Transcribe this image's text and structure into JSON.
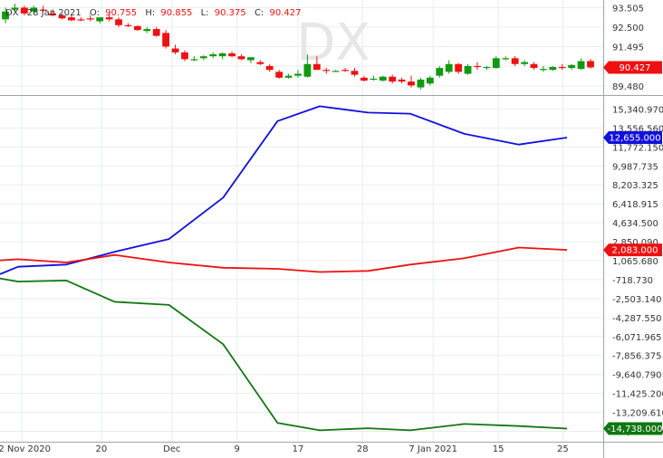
{
  "header": {
    "symbol": "DX",
    "date": "28 Jan 2021",
    "o_label": "O:",
    "o_value": "90.755",
    "h_label": "H:",
    "h_value": "90.855",
    "l_label": "L:",
    "l_value": "90.375",
    "c_label": "C:",
    "c_value": "90.427"
  },
  "watermark": "DX",
  "colors": {
    "up": "#119911",
    "down": "#ee1111",
    "blue": "#1111dd",
    "red": "#ee1111",
    "green": "#117711",
    "grid": "#e9edf0"
  },
  "chart_data": [
    {
      "type": "candlestick",
      "title": "DX",
      "yticks": [
        "93.505",
        "92.500",
        "91.495",
        "90.490",
        "89.480"
      ],
      "ylim": [
        89.1,
        93.8
      ],
      "last_value_label": "90.427",
      "candles": [
        {
          "o": 92.9,
          "h": 93.5,
          "l": 92.7,
          "c": 93.3
        },
        {
          "o": 93.4,
          "h": 93.7,
          "l": 93.3,
          "c": 93.5
        },
        {
          "o": 93.5,
          "h": 93.6,
          "l": 93.1,
          "c": 93.2
        },
        {
          "o": 93.3,
          "h": 93.6,
          "l": 93.2,
          "c": 93.5
        },
        {
          "o": 93.4,
          "h": 93.6,
          "l": 93.3,
          "c": 93.35
        },
        {
          "o": 93.2,
          "h": 93.4,
          "l": 93.05,
          "c": 93.1
        },
        {
          "o": 93.1,
          "h": 93.2,
          "l": 92.9,
          "c": 92.95
        },
        {
          "o": 93.0,
          "h": 93.1,
          "l": 92.8,
          "c": 92.85
        },
        {
          "o": 92.9,
          "h": 93.0,
          "l": 92.8,
          "c": 92.85
        },
        {
          "o": 92.95,
          "h": 93.1,
          "l": 92.8,
          "c": 92.9
        },
        {
          "o": 92.8,
          "h": 93.0,
          "l": 92.7,
          "c": 93.0
        },
        {
          "o": 93.0,
          "h": 93.2,
          "l": 92.8,
          "c": 92.9
        },
        {
          "o": 92.9,
          "h": 93.0,
          "l": 92.5,
          "c": 92.6
        },
        {
          "o": 92.6,
          "h": 92.7,
          "l": 92.5,
          "c": 92.55
        },
        {
          "o": 92.55,
          "h": 92.6,
          "l": 92.3,
          "c": 92.35
        },
        {
          "o": 92.3,
          "h": 92.5,
          "l": 92.2,
          "c": 92.4
        },
        {
          "o": 92.4,
          "h": 92.5,
          "l": 92.0,
          "c": 92.05
        },
        {
          "o": 92.2,
          "h": 92.35,
          "l": 91.4,
          "c": 91.5
        },
        {
          "o": 91.4,
          "h": 91.6,
          "l": 91.1,
          "c": 91.2
        },
        {
          "o": 91.2,
          "h": 91.3,
          "l": 90.75,
          "c": 90.85
        },
        {
          "o": 90.8,
          "h": 91.0,
          "l": 90.75,
          "c": 90.85
        },
        {
          "o": 90.9,
          "h": 91.05,
          "l": 90.8,
          "c": 91.0
        },
        {
          "o": 91.0,
          "h": 91.2,
          "l": 90.9,
          "c": 91.1
        },
        {
          "o": 91.0,
          "h": 91.2,
          "l": 90.85,
          "c": 91.15
        },
        {
          "o": 91.15,
          "h": 91.25,
          "l": 90.95,
          "c": 91.0
        },
        {
          "o": 91.0,
          "h": 91.1,
          "l": 90.8,
          "c": 90.85
        },
        {
          "o": 90.8,
          "h": 90.95,
          "l": 90.65,
          "c": 90.95
        },
        {
          "o": 90.7,
          "h": 90.8,
          "l": 90.55,
          "c": 90.6
        },
        {
          "o": 90.5,
          "h": 90.6,
          "l": 90.2,
          "c": 90.3
        },
        {
          "o": 90.2,
          "h": 90.3,
          "l": 89.85,
          "c": 89.9
        },
        {
          "o": 89.9,
          "h": 90.1,
          "l": 89.85,
          "c": 90.0
        },
        {
          "o": 90.0,
          "h": 90.3,
          "l": 89.9,
          "c": 90.1
        },
        {
          "o": 89.95,
          "h": 91.1,
          "l": 89.9,
          "c": 90.6
        },
        {
          "o": 90.6,
          "h": 91.0,
          "l": 90.3,
          "c": 90.3
        },
        {
          "o": 90.3,
          "h": 90.4,
          "l": 90.1,
          "c": 90.25
        },
        {
          "o": 90.25,
          "h": 90.3,
          "l": 90.2,
          "c": 90.25
        },
        {
          "o": 90.3,
          "h": 90.4,
          "l": 90.2,
          "c": 90.25
        },
        {
          "o": 90.25,
          "h": 90.4,
          "l": 89.95,
          "c": 90.05
        },
        {
          "o": 89.9,
          "h": 90.0,
          "l": 89.7,
          "c": 89.75
        },
        {
          "o": 89.8,
          "h": 90.0,
          "l": 89.75,
          "c": 89.85
        },
        {
          "o": 89.75,
          "h": 90.0,
          "l": 89.7,
          "c": 89.95
        },
        {
          "o": 89.95,
          "h": 90.05,
          "l": 89.6,
          "c": 89.7
        },
        {
          "o": 89.8,
          "h": 89.9,
          "l": 89.6,
          "c": 89.7
        },
        {
          "o": 89.7,
          "h": 90.0,
          "l": 89.4,
          "c": 89.5
        },
        {
          "o": 89.4,
          "h": 89.9,
          "l": 89.3,
          "c": 89.8
        },
        {
          "o": 89.6,
          "h": 90.0,
          "l": 89.5,
          "c": 89.9
        },
        {
          "o": 90.0,
          "h": 90.5,
          "l": 89.9,
          "c": 90.4
        },
        {
          "o": 90.2,
          "h": 90.8,
          "l": 90.1,
          "c": 90.6
        },
        {
          "o": 90.6,
          "h": 90.65,
          "l": 90.1,
          "c": 90.2
        },
        {
          "o": 90.1,
          "h": 90.6,
          "l": 90.05,
          "c": 90.5
        },
        {
          "o": 90.5,
          "h": 90.7,
          "l": 90.3,
          "c": 90.45
        },
        {
          "o": 90.4,
          "h": 90.5,
          "l": 90.3,
          "c": 90.45
        },
        {
          "o": 90.4,
          "h": 91.0,
          "l": 90.35,
          "c": 90.9
        },
        {
          "o": 90.9,
          "h": 91.0,
          "l": 90.8,
          "c": 90.9
        },
        {
          "o": 90.9,
          "h": 91.0,
          "l": 90.5,
          "c": 90.6
        },
        {
          "o": 90.6,
          "h": 90.8,
          "l": 90.5,
          "c": 90.7
        },
        {
          "o": 90.6,
          "h": 90.7,
          "l": 90.3,
          "c": 90.4
        },
        {
          "o": 90.3,
          "h": 90.5,
          "l": 90.2,
          "c": 90.35
        },
        {
          "o": 90.3,
          "h": 90.5,
          "l": 90.25,
          "c": 90.45
        },
        {
          "o": 90.45,
          "h": 90.6,
          "l": 90.3,
          "c": 90.4
        },
        {
          "o": 90.4,
          "h": 90.6,
          "l": 90.3,
          "c": 90.55
        },
        {
          "o": 90.35,
          "h": 90.9,
          "l": 90.3,
          "c": 90.75
        },
        {
          "o": 90.755,
          "h": 90.855,
          "l": 90.375,
          "c": 90.427
        }
      ]
    },
    {
      "type": "line",
      "yticks": [
        "15,340.970",
        "13,556.560",
        "11,772.150",
        "9,987.735",
        "8,203.325",
        "6,418.915",
        "4,634.500",
        "2,850.090",
        "1,065.680",
        "-718.730",
        "-2,503.140",
        "-4,287.550",
        "-6,071.965",
        "-7,856.375",
        "-9,640.790",
        "-11,425.200",
        "-13,209.610",
        "-14,995.000"
      ],
      "ylim": [
        -15800,
        16400
      ],
      "series": [
        {
          "color": "#1111dd",
          "last_label": "12,655.000",
          "x": [
            0,
            0.03,
            0.11,
            0.19,
            0.28,
            0.37,
            0.46,
            0.53,
            0.61,
            0.68,
            0.77,
            0.86,
            0.94
          ],
          "values": [
            -200,
            500,
            700,
            1900,
            3100,
            7000,
            14200,
            15600,
            15000,
            14900,
            13000,
            12000,
            12655
          ]
        },
        {
          "color": "#ee1111",
          "last_label": "2,083.000",
          "x": [
            0,
            0.03,
            0.11,
            0.19,
            0.28,
            0.37,
            0.46,
            0.53,
            0.61,
            0.68,
            0.77,
            0.86,
            0.94
          ],
          "values": [
            1100,
            1200,
            900,
            1600,
            900,
            400,
            300,
            0,
            100,
            700,
            1300,
            2300,
            2083
          ]
        },
        {
          "color": "#117711",
          "last_label": "-14,738.000",
          "x": [
            0,
            0.03,
            0.11,
            0.19,
            0.28,
            0.37,
            0.46,
            0.53,
            0.61,
            0.68,
            0.77,
            0.86,
            0.94
          ],
          "values": [
            -600,
            -900,
            -800,
            -2800,
            -3100,
            -6800,
            -14200,
            -14900,
            -14700,
            -14900,
            -14300,
            -14500,
            -14738
          ]
        }
      ]
    }
  ],
  "xaxis": {
    "ticks": [
      "12 Nov 2020",
      "20",
      "Dec",
      "9",
      "17",
      "28",
      "7 Jan 2021",
      "15",
      "25"
    ],
    "positions": [
      0.036,
      0.168,
      0.285,
      0.393,
      0.494,
      0.601,
      0.718,
      0.826,
      0.933
    ]
  }
}
